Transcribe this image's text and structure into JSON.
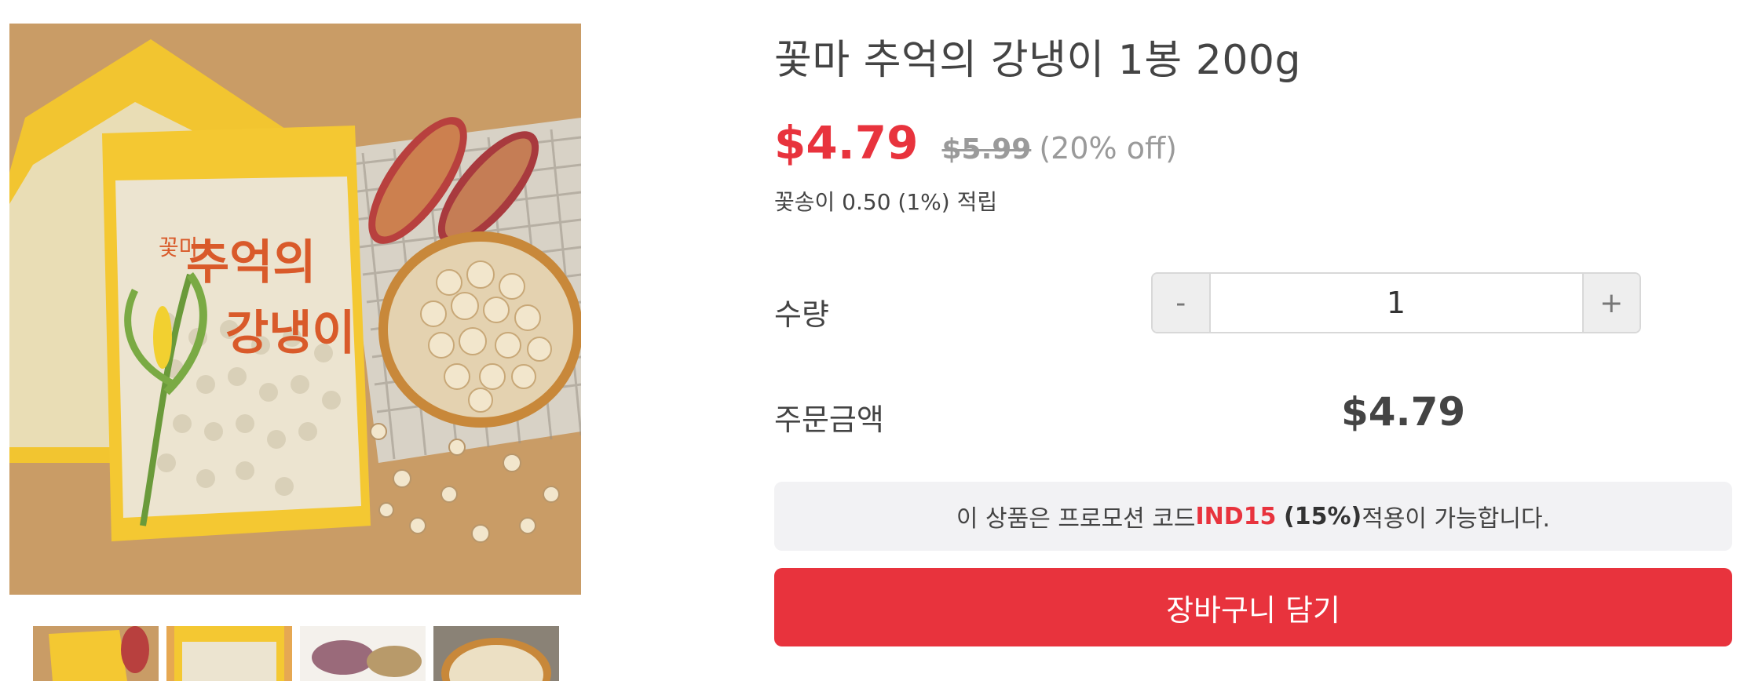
{
  "product": {
    "title": "꽃마 추억의 강냉이 1봉 200g",
    "price_sale": "$4.79",
    "price_original": "$5.99",
    "discount": "(20% off)",
    "points_text": "꽃송이 0.50 (1%) 적립"
  },
  "quantity": {
    "label": "수량",
    "minus_label": "-",
    "plus_label": "+",
    "value": "1"
  },
  "order_total": {
    "label": "주문금액",
    "value": "$4.79"
  },
  "promo": {
    "prefix": "이 상품은 프로모션 코드 ",
    "code": "IND15",
    "percent": "(15%)",
    "suffix": " 적용이 가능합니다."
  },
  "cart_button": {
    "label": "장바구니 담기"
  },
  "gallery": {
    "package_text_line1": "추억의",
    "package_text_line2": "강냉이",
    "brand_mark": "꽃마",
    "thumbnails": [
      "thumbnail-1",
      "thumbnail-2",
      "thumbnail-3",
      "thumbnail-4"
    ]
  },
  "colors": {
    "accent": "#e8333d",
    "muted": "#9a9a9a",
    "text": "#444444",
    "promo_bg": "#f2f2f4"
  }
}
